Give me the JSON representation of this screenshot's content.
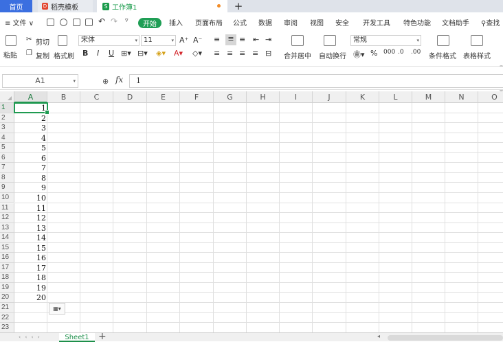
{
  "tabs": {
    "home": "首页",
    "docer": "稻壳模板",
    "workbook": "工作簿1",
    "add": "+"
  },
  "menu": {
    "file": "≡ 文件 ∨",
    "items": [
      {
        "label": "开始",
        "key": "start"
      },
      {
        "label": "插入",
        "key": "insert"
      },
      {
        "label": "页面布局",
        "key": "page-layout"
      },
      {
        "label": "公式",
        "key": "formulas"
      },
      {
        "label": "数据",
        "key": "data"
      },
      {
        "label": "审阅",
        "key": "review"
      },
      {
        "label": "视图",
        "key": "view"
      },
      {
        "label": "安全",
        "key": "security"
      },
      {
        "label": "开发工具",
        "key": "developer"
      },
      {
        "label": "特色功能",
        "key": "features"
      },
      {
        "label": "文档助手",
        "key": "doc-assistant"
      },
      {
        "label": "查找",
        "key": "find"
      }
    ]
  },
  "ribbon": {
    "paste": "粘贴",
    "cut": "剪切",
    "copy": "复制",
    "format_painter": "格式刷",
    "font_name": "宋体",
    "font_size": "11",
    "bold": "B",
    "italic": "I",
    "underline": "U",
    "merge_center": "合并居中",
    "wrap_text": "自动换行",
    "number_format": "常规",
    "conditional_format": "条件格式",
    "table_style": "表格样式"
  },
  "formula_bar": {
    "name_box": "A1",
    "fx": "fx",
    "content": "1"
  },
  "columns": [
    "A",
    "B",
    "C",
    "D",
    "E",
    "F",
    "G",
    "H",
    "I",
    "J",
    "K",
    "L",
    "M",
    "N",
    "O"
  ],
  "rows": [
    "1",
    "2",
    "3",
    "4",
    "5",
    "6",
    "7",
    "8",
    "9",
    "10",
    "11",
    "12",
    "13",
    "14",
    "15",
    "16",
    "17",
    "18",
    "19",
    "20",
    "21",
    "22",
    "23"
  ],
  "cells_A": [
    "1",
    "2",
    "3",
    "4",
    "5",
    "6",
    "7",
    "8",
    "9",
    "10",
    "11",
    "12",
    "13",
    "14",
    "15",
    "16",
    "17",
    "18",
    "19",
    "20"
  ],
  "selected_cell": "A1",
  "sheets": [
    {
      "name": "Sheet1",
      "active": true
    }
  ],
  "colors": {
    "accent": "#1f9e55",
    "home_tab": "#3b6fe0"
  }
}
